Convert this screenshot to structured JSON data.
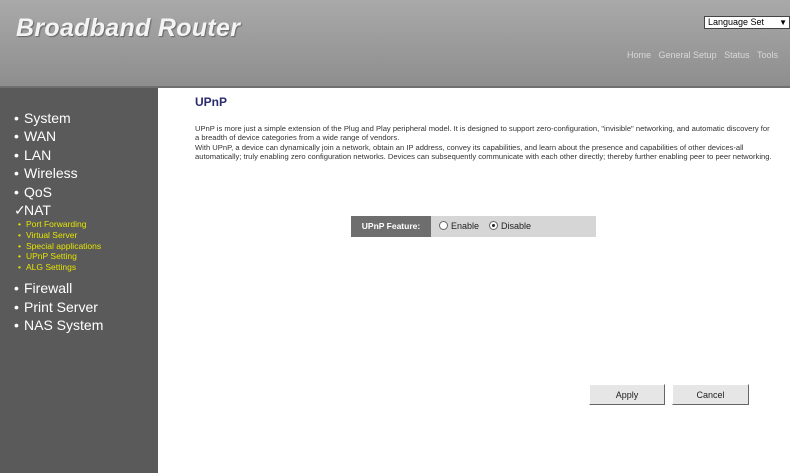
{
  "header": {
    "brand": "Broadband Router",
    "language_select": "Language Set",
    "links": [
      "Home",
      "General Setup",
      "Status",
      "Tools"
    ]
  },
  "sidebar": {
    "items": [
      {
        "bullet": "•",
        "label": "System"
      },
      {
        "bullet": "•",
        "label": "WAN"
      },
      {
        "bullet": "•",
        "label": "LAN"
      },
      {
        "bullet": "•",
        "label": "Wireless"
      },
      {
        "bullet": "•",
        "label": "QoS"
      },
      {
        "bullet": "✓",
        "label": "NAT"
      }
    ],
    "subitems": [
      {
        "bullet": "•",
        "label": "Port Forwarding"
      },
      {
        "bullet": "•",
        "label": "Virtual Server"
      },
      {
        "bullet": "•",
        "label": "Special applications"
      },
      {
        "bullet": "•",
        "label": "UPnP Setting"
      },
      {
        "bullet": "•",
        "label": "ALG Settings"
      }
    ],
    "items_after": [
      {
        "bullet": "•",
        "label": "Firewall"
      },
      {
        "bullet": "•",
        "label": "Print Server"
      },
      {
        "bullet": "•",
        "label": "NAS System"
      }
    ]
  },
  "main": {
    "title": "UPnP",
    "description": [
      "UPnP is more just a simple extension of the Plug and Play peripheral model. It is designed to support zero-configuration, \"invisible\" networking, and automatic discovery for a breadth of device categories from a wide range of vendors.",
      "With UPnP, a device can dynamically join a network, obtain an IP address, convey its capabilities, and learn about the presence and capabilities of other devices-all automatically; truly enabling zero configuration networks. Devices can subsequently communicate with each other directly; thereby further enabling peer to peer networking."
    ],
    "feature_label": "UPnP Feature:",
    "option_enable": "Enable",
    "option_disable": "Disable",
    "selected": "Disable",
    "apply": "Apply",
    "cancel": "Cancel"
  },
  "colors": {
    "header_bg": "#9a9a9a",
    "sidebar_bg": "#5a5a5a",
    "submenu_text": "#e4e400",
    "title_text": "#2a2a6e"
  }
}
